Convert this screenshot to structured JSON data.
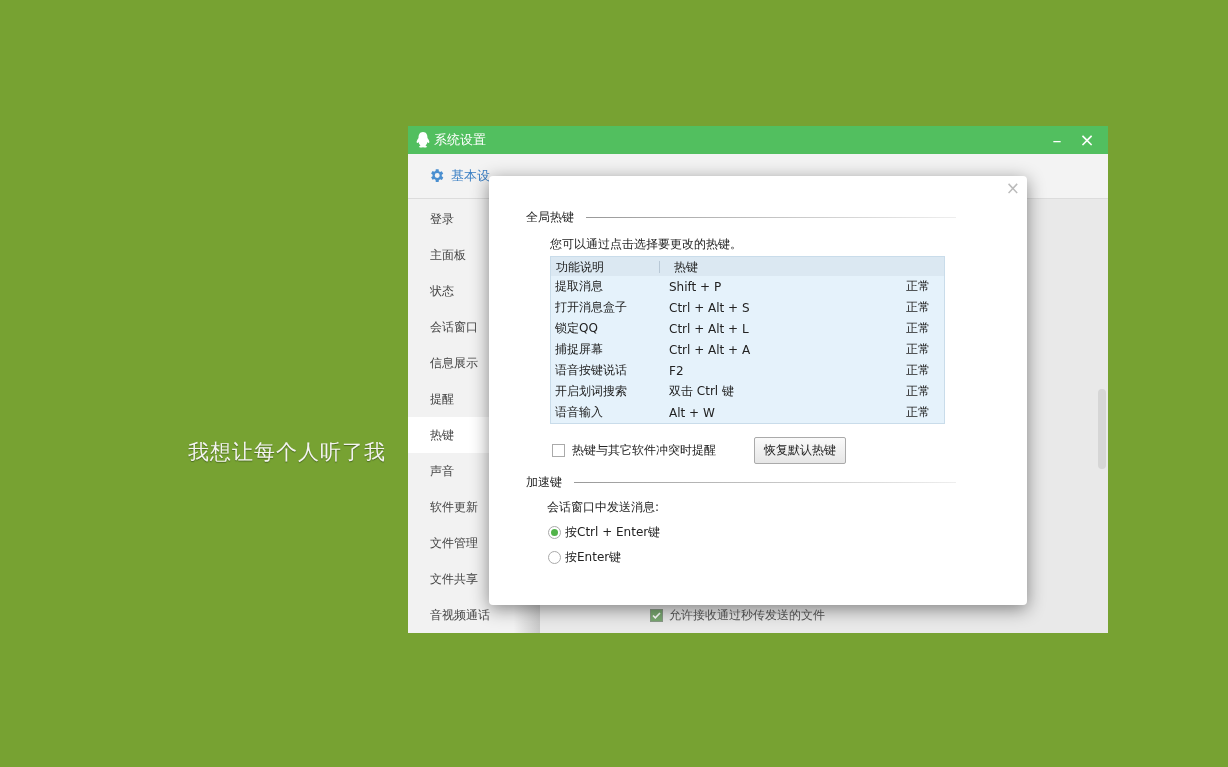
{
  "subtitle": "我想让每个人听了我",
  "window": {
    "title": "系统设置",
    "minimize": "–",
    "close": "×"
  },
  "toolbar": {
    "tabs": [
      {
        "label": "基本设",
        "selected": true
      }
    ]
  },
  "sidebar": {
    "items": [
      {
        "label": "登录",
        "selected": false
      },
      {
        "label": "主面板",
        "selected": false
      },
      {
        "label": "状态",
        "selected": false
      },
      {
        "label": "会话窗口",
        "selected": false
      },
      {
        "label": "信息展示",
        "selected": false
      },
      {
        "label": "提醒",
        "selected": false
      },
      {
        "label": "热键",
        "selected": true
      },
      {
        "label": "声音",
        "selected": false
      },
      {
        "label": "软件更新",
        "selected": false
      },
      {
        "label": "文件管理",
        "selected": false
      },
      {
        "label": "文件共享",
        "selected": false
      },
      {
        "label": "音视频通话",
        "selected": false
      }
    ]
  },
  "background_option": {
    "label": "允许接收通过秒传发送的文件",
    "checked": true
  },
  "dialog": {
    "close": "×",
    "global_hotkeys": {
      "heading": "全局热键",
      "hint": "您可以通过点击选择要更改的热键。",
      "table": {
        "columns": [
          "功能说明",
          "热键"
        ],
        "rows": [
          {
            "function": "提取消息",
            "hotkey": "Shift + P",
            "column_3": "正常"
          },
          {
            "function": "打开消息盒子",
            "hotkey": "Ctrl + Alt + S",
            "column_3": "正常"
          },
          {
            "function": "锁定QQ",
            "hotkey": "Ctrl + Alt + L",
            "column_3": "正常"
          },
          {
            "function": "捕捉屏幕",
            "hotkey": "Ctrl + Alt + A",
            "column_3": "正常"
          },
          {
            "function": "语音按键说话",
            "hotkey": "F2",
            "column_3": "正常"
          },
          {
            "function": "开启划词搜索",
            "hotkey": "双击 Ctrl 键",
            "column_3": "正常"
          },
          {
            "function": "语音输入",
            "hotkey": "Alt + W",
            "column_3": "正常"
          }
        ]
      },
      "conflict_alert": {
        "label": "热键与其它软件冲突时提醒",
        "checked": false
      },
      "restore_button": "恢复默认热键"
    },
    "accelerators": {
      "heading": "加速键",
      "prompt": "会话窗口中发送消息:",
      "options": [
        {
          "label": "按Ctrl + Enter键",
          "selected": true
        },
        {
          "label": "按Enter键",
          "selected": false
        }
      ]
    }
  }
}
